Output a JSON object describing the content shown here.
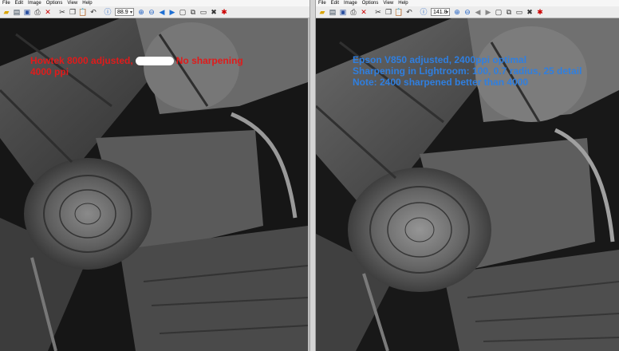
{
  "menus": [
    "File",
    "Edit",
    "Image",
    "Options",
    "View",
    "Help"
  ],
  "left": {
    "zoom": "88.9",
    "caption_line1_a": "Howtek 8000 adjusted,",
    "caption_line1_no": "No",
    "caption_line1_b": "sharpening",
    "caption_line2": "4000 ppi"
  },
  "right": {
    "zoom": "141.8",
    "caption_line1": "Epson V850 adjusted, 2400ppi optimal",
    "caption_line2": "Sharpening in Lightroom: 100, 0.7 radius, 25 detail",
    "caption_line3": "Note: 2400 sharpened better than 4000"
  },
  "colors": {
    "caption_left": "#e01b1b",
    "caption_right": "#2f7fe0"
  },
  "icons": [
    "open-icon",
    "scan-icon",
    "save-icon",
    "print-icon",
    "delete-icon",
    "cut-icon",
    "copy-icon",
    "paste-icon",
    "undo-icon",
    "info-icon",
    "zoom-in-icon",
    "zoom-out-icon",
    "back-icon",
    "forward-icon",
    "page-icon",
    "copy-page-icon",
    "fit-icon",
    "tools-icon",
    "exit-icon"
  ]
}
